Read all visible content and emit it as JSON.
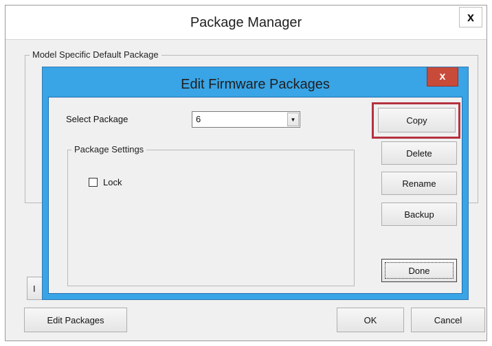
{
  "outer_window": {
    "title": "Package Manager",
    "close_label": "x",
    "group_label": "Model Specific Default Package",
    "partial_button_label": "I",
    "buttons": {
      "edit_packages": "Edit Packages",
      "ok": "OK",
      "cancel": "Cancel"
    }
  },
  "dialog": {
    "title": "Edit Firmware Packages",
    "close_label": "x",
    "select_package_label": "Select Package",
    "select_package_value": "6",
    "dropdown_arrow": "▼",
    "package_settings_label": "Package Settings",
    "lock_label": "Lock",
    "buttons": {
      "copy": "Copy",
      "delete": "Delete",
      "rename": "Rename",
      "backup": "Backup",
      "done": "Done"
    }
  },
  "colors": {
    "dialog_frame": "#39a4e6",
    "close_button": "#c84a39",
    "highlight_border": "#b4323f",
    "window_background": "#f0f0f0"
  },
  "icons": {
    "outer_close": "close-icon",
    "dialog_close": "close-icon",
    "dropdown": "chevron-down-icon"
  }
}
